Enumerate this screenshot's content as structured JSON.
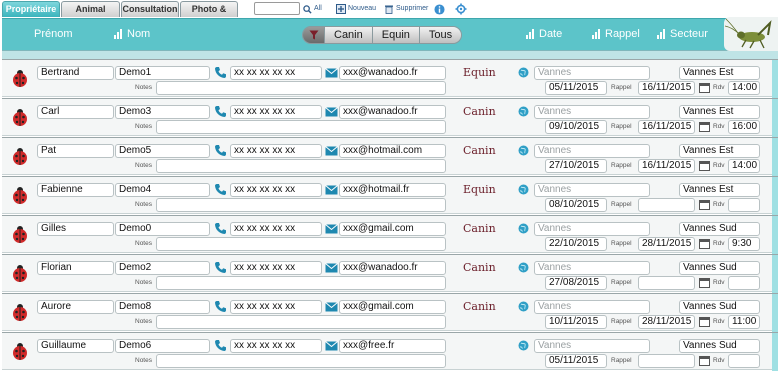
{
  "tabs": [
    {
      "label": "Propriétaire",
      "active": true
    },
    {
      "label": "Animal",
      "active": false
    },
    {
      "label": "Consultation",
      "active": false
    },
    {
      "label": "Photo & Vidéo",
      "active": false
    }
  ],
  "toolbar": {
    "search_value": "",
    "all_label": "All",
    "new_label": "Nouveau",
    "delete_label": "Supprimer"
  },
  "header": {
    "firstname": "Prénom",
    "lastname": "Nom",
    "filters": [
      "Canin",
      "Equin",
      "Tous"
    ],
    "date": "Date",
    "reminder": "Rappel",
    "sector": "Secteur"
  },
  "field_labels": {
    "notes": "Notes",
    "reminder": "Rappel",
    "rdv": "Rdv"
  },
  "colors": {
    "accent": "#5cc4c9",
    "animal_text": "#6b1f2a"
  },
  "rows": [
    {
      "firstname": "Bertrand",
      "lastname": "Demo1",
      "phone": "xx xx xx xx xx",
      "email": "xxx@wanadoo.fr",
      "animal": "Equin",
      "city": "Vannes",
      "date": "05/11/2015",
      "reminder": "16/11/2015",
      "sector": "Vannes Est",
      "rdv": "14:00",
      "notes": ""
    },
    {
      "firstname": "Carl",
      "lastname": "Demo3",
      "phone": "xx xx xx xx xx",
      "email": "xxx@wanadoo.fr",
      "animal": "Canin",
      "city": "Vannes",
      "date": "09/10/2015",
      "reminder": "16/11/2015",
      "sector": "Vannes Est",
      "rdv": "16:00",
      "notes": ""
    },
    {
      "firstname": "Pat",
      "lastname": "Demo5",
      "phone": "xx xx xx xx xx",
      "email": "xxx@hotmail.com",
      "animal": "Canin",
      "city": "Vannes",
      "date": "27/10/2015",
      "reminder": "16/11/2015",
      "sector": "Vannes Est",
      "rdv": "14:00",
      "notes": ""
    },
    {
      "firstname": "Fabienne",
      "lastname": "Demo4",
      "phone": "xx xx xx xx xx",
      "email": "xxx@hotmail.fr",
      "animal": "Equin",
      "city": "Vannes",
      "date": "08/10/2015",
      "reminder": "",
      "sector": "Vannes Est",
      "rdv": "",
      "notes": ""
    },
    {
      "firstname": "Gilles",
      "lastname": "Demo0",
      "phone": "xx xx xx xx xx",
      "email": "xxx@gmail.com",
      "animal": "Canin",
      "city": "Vannes",
      "date": "22/10/2015",
      "reminder": "28/11/2015",
      "sector": "Vannes Sud",
      "rdv": "9:30",
      "notes": ""
    },
    {
      "firstname": "Florian",
      "lastname": "Demo2",
      "phone": "xx xx xx xx xx",
      "email": "xxx@wanadoo.fr",
      "animal": "Canin",
      "city": "Vannes",
      "date": "27/08/2015",
      "reminder": "",
      "sector": "Vannes Sud",
      "rdv": "",
      "notes": ""
    },
    {
      "firstname": "Aurore",
      "lastname": "Demo8",
      "phone": "xx xx xx xx xx",
      "email": "xxx@gmail.com",
      "animal": "Canin",
      "city": "Vannes",
      "date": "10/11/2015",
      "reminder": "28/11/2015",
      "sector": "Vannes Sud",
      "rdv": "11:00",
      "notes": ""
    },
    {
      "firstname": "Guillaume",
      "lastname": "Demo6",
      "phone": "xx xx xx xx xx",
      "email": "xxx@free.fr",
      "animal": "",
      "city": "Vannes",
      "date": "05/11/2015",
      "reminder": "",
      "sector": "Vannes Sud",
      "rdv": "",
      "notes": ""
    }
  ]
}
